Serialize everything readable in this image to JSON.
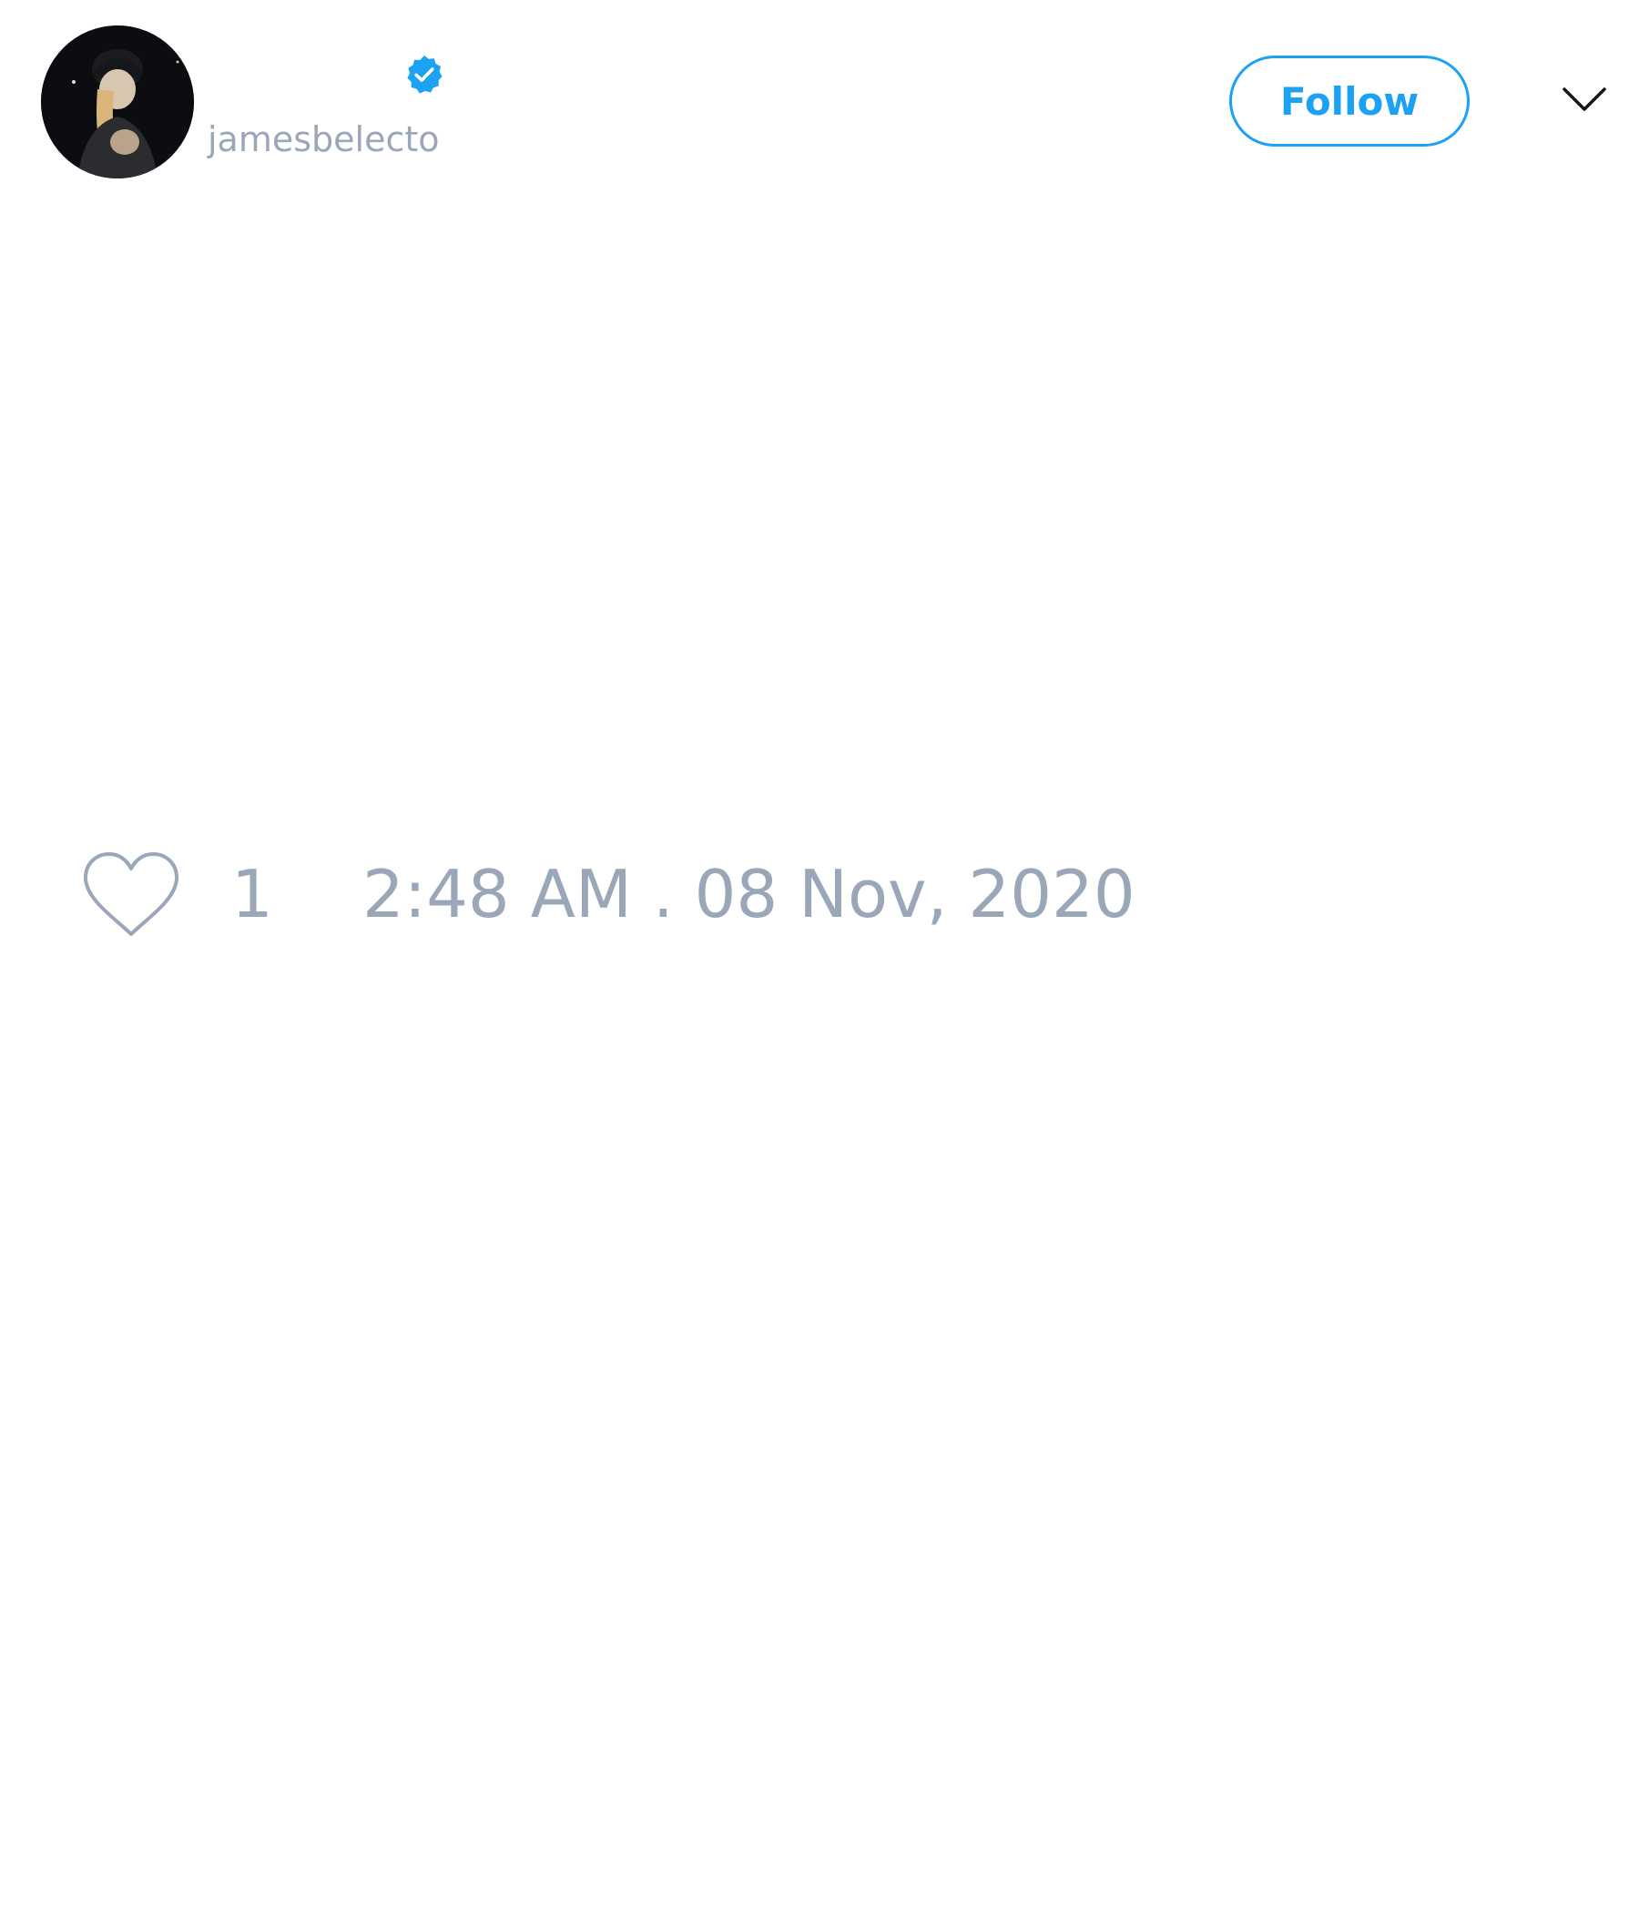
{
  "tweet": {
    "author": {
      "display_name": "",
      "handle": "jamesbelecto",
      "verified": true,
      "avatar_icon": "profile-photo"
    },
    "follow_label": "Follow",
    "menu_icon": "chevron-down-icon",
    "likes": {
      "icon": "heart-outline-icon",
      "count": "1"
    },
    "timestamp": "2:48 AM . 08 Nov, 2020"
  },
  "colors": {
    "accent": "#1da1f2",
    "muted_text": "#9aa7b8",
    "background": "#ffffff"
  }
}
